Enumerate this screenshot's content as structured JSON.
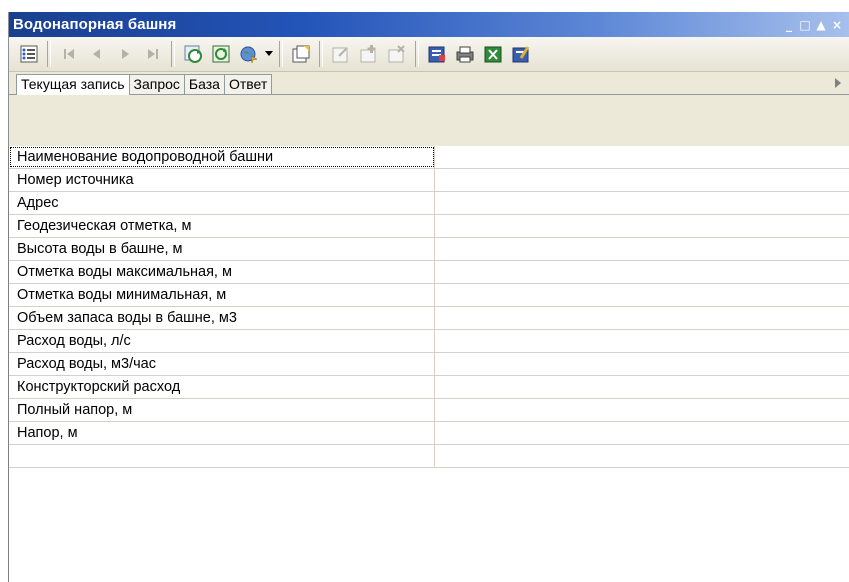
{
  "window": {
    "title": "Водонапорная башня",
    "controls": [
      "_",
      "□",
      "▲",
      "×"
    ]
  },
  "toolbar": {
    "buttons": [
      "grid-view-icon",
      "first-record-icon",
      "prev-record-icon",
      "next-record-icon",
      "last-record-icon",
      "refresh-icon",
      "reload-icon",
      "globe-icon",
      "dropdown-arrow-icon",
      "new-document-icon",
      "edit-record-icon",
      "add-record-icon",
      "delete-record-icon",
      "export-icon",
      "print-icon",
      "excel-icon",
      "properties-icon"
    ]
  },
  "tabs": [
    {
      "label": "Текущая запись",
      "active": true
    },
    {
      "label": "Запрос",
      "active": false
    },
    {
      "label": "База",
      "active": false
    },
    {
      "label": "Ответ",
      "active": false
    }
  ],
  "fields": [
    {
      "label": "Наименование водопроводной башни",
      "value": ""
    },
    {
      "label": "Номер источника",
      "value": ""
    },
    {
      "label": "Адрес",
      "value": ""
    },
    {
      "label": "Геодезическая отметка, м",
      "value": ""
    },
    {
      "label": "Высота воды в башне, м",
      "value": ""
    },
    {
      "label": "Отметка воды максимальная, м",
      "value": ""
    },
    {
      "label": "Отметка воды минимальная, м",
      "value": ""
    },
    {
      "label": "Объем запаса воды в башне, м3",
      "value": ""
    },
    {
      "label": "Расход воды, л/с",
      "value": ""
    },
    {
      "label": "Расход воды, м3/час",
      "value": ""
    },
    {
      "label": "Конструкторский расход",
      "value": ""
    },
    {
      "label": "Полный напор, м",
      "value": ""
    },
    {
      "label": "Напор, м",
      "value": ""
    },
    {
      "label": "",
      "value": ""
    }
  ],
  "colors": {
    "title_bar": "#2354b8",
    "window_bg": "#ece9d8"
  }
}
